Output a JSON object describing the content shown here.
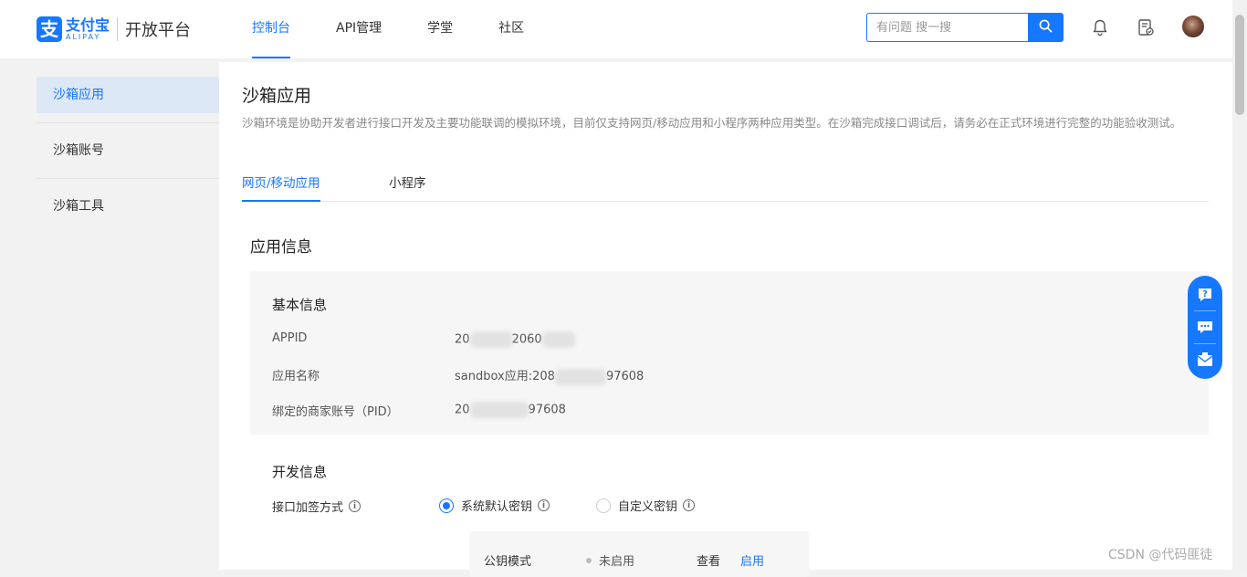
{
  "header": {
    "logo_mark": "支",
    "logo_cn": "支付宝",
    "logo_en": "ALIPAY",
    "platform": "开放平台",
    "nav": [
      {
        "label": "控制台",
        "active": true
      },
      {
        "label": "API管理",
        "active": false
      },
      {
        "label": "学堂",
        "active": false
      },
      {
        "label": "社区",
        "active": false
      }
    ],
    "search": {
      "placeholder": "有问题 搜一搜"
    },
    "icons": [
      "search-icon",
      "bell-icon",
      "document-check-icon",
      "avatar"
    ]
  },
  "sidebar": {
    "items": [
      {
        "label": "沙箱应用",
        "active": true
      },
      {
        "label": "沙箱账号",
        "active": false
      },
      {
        "label": "沙箱工具",
        "active": false
      }
    ]
  },
  "main": {
    "title": "沙箱应用",
    "description": "沙箱环境是协助开发者进行接口开发及主要功能联调的模拟环境，目前仅支持网页/移动应用和小程序两种应用类型。在沙箱完成接口调试后，请务必在正式环境进行完整的功能验收测试。",
    "tabs": [
      {
        "label": "网页/移动应用",
        "active": true
      },
      {
        "label": "小程序",
        "active": false
      }
    ],
    "section_title": "应用信息",
    "basic": {
      "heading": "基本信息",
      "appid_label": "APPID",
      "appid_value_a": "20",
      "appid_value_b": "2060",
      "appname_label": "应用名称",
      "appname_value_a": "sandbox应用:208",
      "appname_value_b": "97608",
      "pid_label": "绑定的商家账号（PID）",
      "pid_value_a": "20",
      "pid_value_b": "97608"
    },
    "dev": {
      "heading": "开发信息",
      "sign_label": "接口加签方式",
      "radio_default": "系统默认密钥",
      "radio_custom": "自定义密钥",
      "key_mode_label": "公钥模式",
      "key_status": "未启用",
      "view_label": "查看",
      "enable_label": "启用"
    }
  },
  "float_panel": {
    "icons": [
      "help-question-icon",
      "chat-icon",
      "feedback-mail-icon"
    ]
  },
  "watermark": "CSDN @代码匪徒",
  "colors": {
    "accent": "#1677ff",
    "sidebar_active_bg": "#dde8f6",
    "page_bg": "#f2f2f2"
  }
}
